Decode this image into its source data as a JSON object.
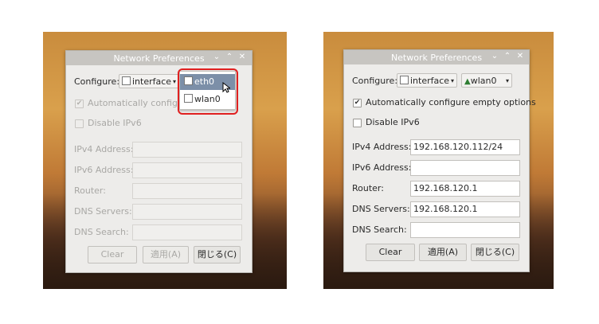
{
  "left": {
    "window_title": "Network Preferences",
    "configure_label": "Configure:",
    "interface_combo": "interface",
    "iface_selected": "eth0",
    "dropdown_items": [
      "eth0",
      "wlan0"
    ],
    "auto_config_label": "Automatically configur",
    "auto_config_checked": true,
    "disable_ipv6_label": "Disable IPv6",
    "ipv4_label": "IPv4 Address:",
    "ipv6_label": "IPv6 Address:",
    "router_label": "Router:",
    "dns_servers_label": "DNS Servers:",
    "dns_search_label": "DNS Search:",
    "buttons": {
      "clear": "Clear",
      "apply": "適用(A)",
      "close": "閉じる(C)"
    }
  },
  "right": {
    "window_title": "Network Preferences",
    "configure_label": "Configure:",
    "interface_combo": "interface",
    "iface_selected": "wlan0",
    "auto_config_label": "Automatically configure empty options",
    "auto_config_checked": true,
    "disable_ipv6_label": "Disable IPv6",
    "ipv4_label": "IPv4 Address:",
    "ipv4_value": "192.168.120.112/24",
    "ipv6_label": "IPv6 Address:",
    "ipv6_value": "",
    "router_label": "Router:",
    "router_value": "192.168.120.1",
    "dns_servers_label": "DNS Servers:",
    "dns_servers_value": "192.168.120.1",
    "dns_search_label": "DNS Search:",
    "dns_search_value": "",
    "buttons": {
      "clear": "Clear",
      "apply": "適用(A)",
      "close": "閉じる(C)"
    }
  },
  "icons": {
    "window_controls": [
      "chevron-down-icon",
      "chevron-up-icon",
      "close-icon"
    ],
    "combo_arrow": "chevron-down-icon"
  },
  "colors": {
    "highlight_box": "#e02020",
    "menu_selection": "#7c8fa8"
  }
}
